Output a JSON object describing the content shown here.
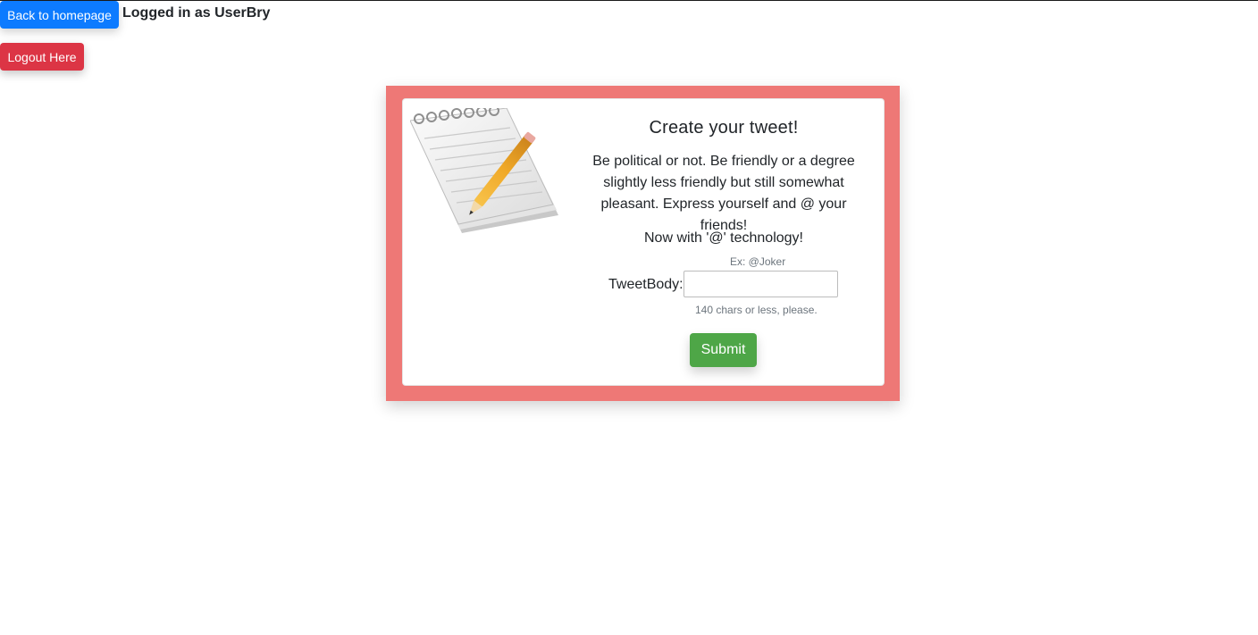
{
  "header": {
    "home_button": "Back to homepage",
    "logged_in_text": "Logged in as UserBry",
    "logout_button": "Logout Here"
  },
  "tweet_form": {
    "title": "Create your tweet!",
    "description": "Be political or not. Be friendly or a degree slightly less friendly but still somewhat pleasant. Express yourself and @ your friends!",
    "tech_note": "Now with '@' technology!",
    "mention_hint": "Ex: @Joker",
    "field_label": "TweetBody:",
    "field_value": "",
    "length_hint": "140 chars or less, please.",
    "submit_label": "Submit",
    "illustration": "notepad-pencil-icon"
  },
  "colors": {
    "home_button": "#0d7bff",
    "logout_button": "#dc3545",
    "frame": "#ee7876",
    "submit_button": "#4ea647"
  }
}
